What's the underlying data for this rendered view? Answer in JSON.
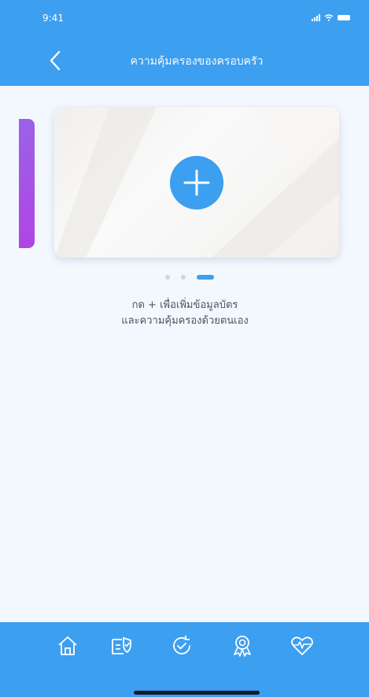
{
  "status_bar": {
    "time": "9:41"
  },
  "header": {
    "title": "ความคุ้มครองของครอบครัว",
    "back_icon": "chevron-left-icon"
  },
  "carousel": {
    "add_icon": "plus-icon",
    "page_count": 3,
    "active_page": 3
  },
  "hint": {
    "line1": "กด + เพื่อเพิ่มข้อมูลบัตร",
    "line2": "และความคุ้มครองด้วยตนเอง"
  },
  "tab_bar": {
    "tabs": [
      {
        "icon": "home-icon"
      },
      {
        "icon": "policy-check-icon"
      },
      {
        "icon": "refresh-check-icon"
      },
      {
        "icon": "award-icon"
      },
      {
        "icon": "heart-pulse-icon"
      }
    ]
  },
  "colors": {
    "primary": "#3d9ff0",
    "background": "#f3f8ff",
    "peek_card": "#a855e6",
    "text": "#4b5563"
  }
}
